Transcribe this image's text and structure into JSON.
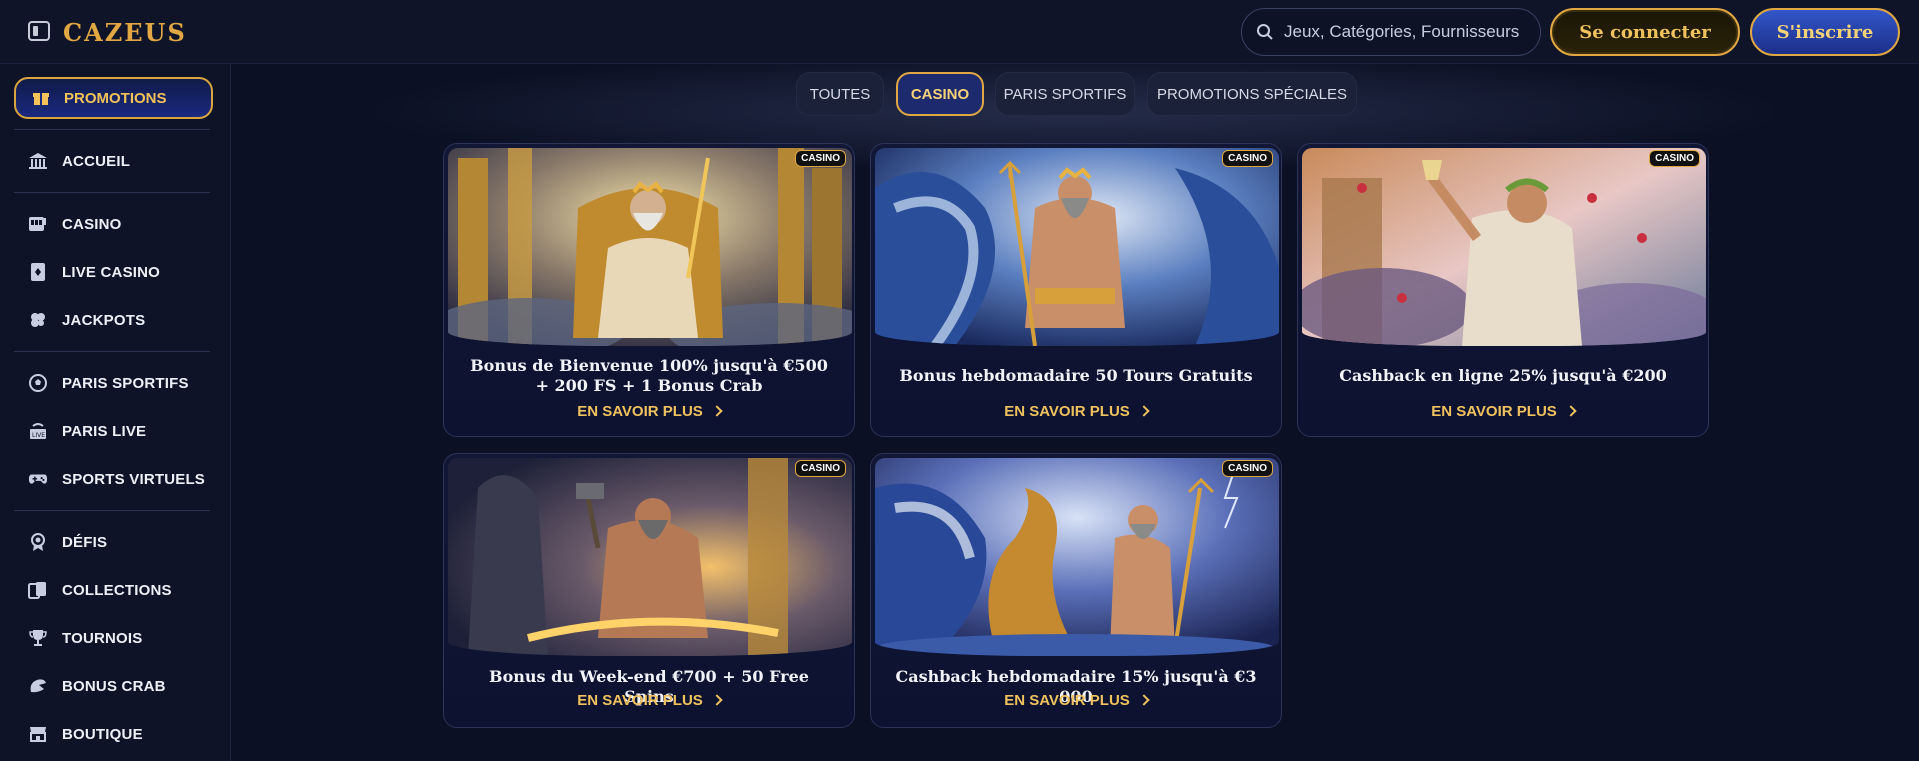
{
  "header": {
    "logo": "CAZEUS",
    "search_placeholder": "Jeux, Catégories, Fournisseurs",
    "login_label": "Se connecter",
    "signup_label": "S'inscrire"
  },
  "sidebar": {
    "promo_label": "PROMOTIONS",
    "items": [
      {
        "label": "ACCUEIL",
        "icon": "bank-icon"
      },
      {
        "label": "CASINO",
        "icon": "slot-machine-icon"
      },
      {
        "label": "LIVE CASINO",
        "icon": "playing-card-icon"
      },
      {
        "label": "JACKPOTS",
        "icon": "clover-icon"
      },
      {
        "label": "PARIS SPORTIFS",
        "icon": "soccer-ball-icon"
      },
      {
        "label": "PARIS LIVE",
        "icon": "live-tv-icon"
      },
      {
        "label": "SPORTS VIRTUELS",
        "icon": "gamepad-icon"
      },
      {
        "label": "DÉFIS",
        "icon": "medal-icon"
      },
      {
        "label": "COLLECTIONS",
        "icon": "cards-icon"
      },
      {
        "label": "TOURNOIS",
        "icon": "trophy-icon"
      },
      {
        "label": "BONUS CRAB",
        "icon": "claw-icon"
      },
      {
        "label": "BOUTIQUE",
        "icon": "shop-icon"
      }
    ]
  },
  "tabs": [
    {
      "label": "TOUTES",
      "active": false
    },
    {
      "label": "CASINO",
      "active": true
    },
    {
      "label": "PARIS SPORTIFS",
      "active": false
    },
    {
      "label": "PROMOTIONS SPÉCIALES",
      "active": false
    }
  ],
  "cards": [
    {
      "badge": "CASINO",
      "title": "Bonus de Bienvenue 100% jusqu'à €500 + 200 FS + 1 Bonus Crab",
      "cta": "EN SAVOIR PLUS"
    },
    {
      "badge": "CASINO",
      "title": "Bonus hebdomadaire 50 Tours Gratuits",
      "cta": "EN SAVOIR PLUS"
    },
    {
      "badge": "CASINO",
      "title": "Cashback en ligne 25% jusqu'à €200",
      "cta": "EN SAVOIR PLUS"
    },
    {
      "badge": "CASINO",
      "title": "Bonus du Week-end €700 + 50 Free Spins",
      "cta": "EN SAVOIR PLUS"
    },
    {
      "badge": "CASINO",
      "title": "Cashback hebdomadaire 15% jusqu'à €3 000",
      "cta": "EN SAVOIR PLUS"
    }
  ],
  "colors": {
    "gold": "#e0a743",
    "navy": "#0b1024",
    "accent_blue": "#1d2a6e"
  }
}
